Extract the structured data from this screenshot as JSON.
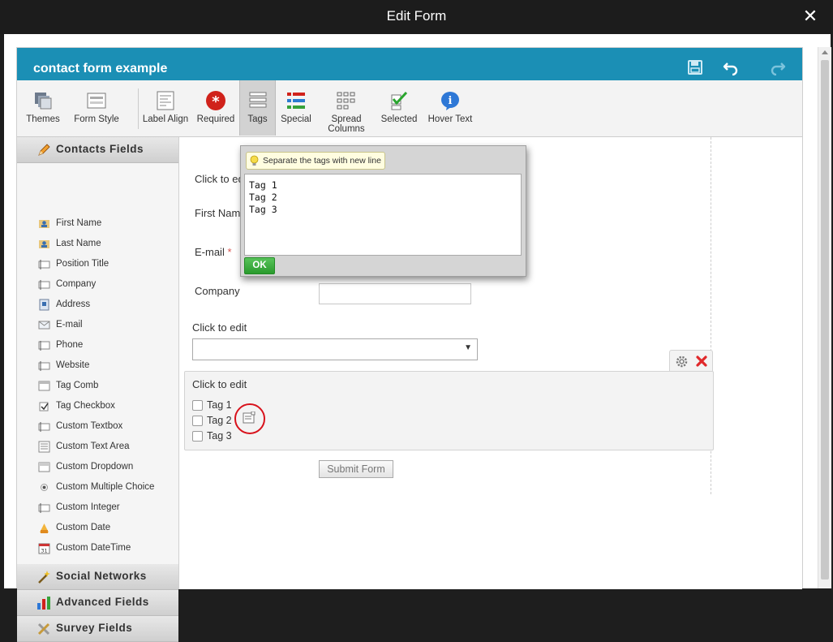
{
  "window": {
    "title": "Edit Form"
  },
  "editor": {
    "form_title": "contact form example"
  },
  "toolbar": {
    "themes": "Themes",
    "form_style": "Form Style",
    "label_align": "Label Align",
    "required": "Required",
    "tags": "Tags",
    "special": "Special",
    "spread_columns_1": "Spread",
    "spread_columns_2": "Columns",
    "selected": "Selected",
    "hover_text": "Hover Text"
  },
  "sidebar": {
    "contacts_fields": "Contacts Fields",
    "social_networks": "Social Networks",
    "advanced_fields": "Advanced Fields",
    "survey_fields": "Survey Fields",
    "items": [
      "First Name",
      "Last Name",
      "Position Title",
      "Company",
      "Address",
      "E-mail",
      "Phone",
      "Website",
      "Tag Comb",
      "Tag Checkbox",
      "Custom Textbox",
      "Custom Text Area",
      "Custom Dropdown",
      "Custom Multiple Choice",
      "Custom Integer",
      "Custom Date",
      "Custom DateTime"
    ]
  },
  "form": {
    "click_to_edit_top": "Click to ed",
    "first_name": "First Nam",
    "email": "E-mail",
    "email_required": "*",
    "company": "Company",
    "dropdown_label": "Click to edit",
    "checkbox_label": "Click to edit",
    "checkboxes": [
      "Tag 1",
      "Tag 2",
      "Tag 3"
    ],
    "submit": "Submit Form"
  },
  "popup": {
    "hint": "Separate the tags with new line",
    "tags_text": "Tag 1\nTag 2\nTag 3",
    "ok": "OK"
  }
}
